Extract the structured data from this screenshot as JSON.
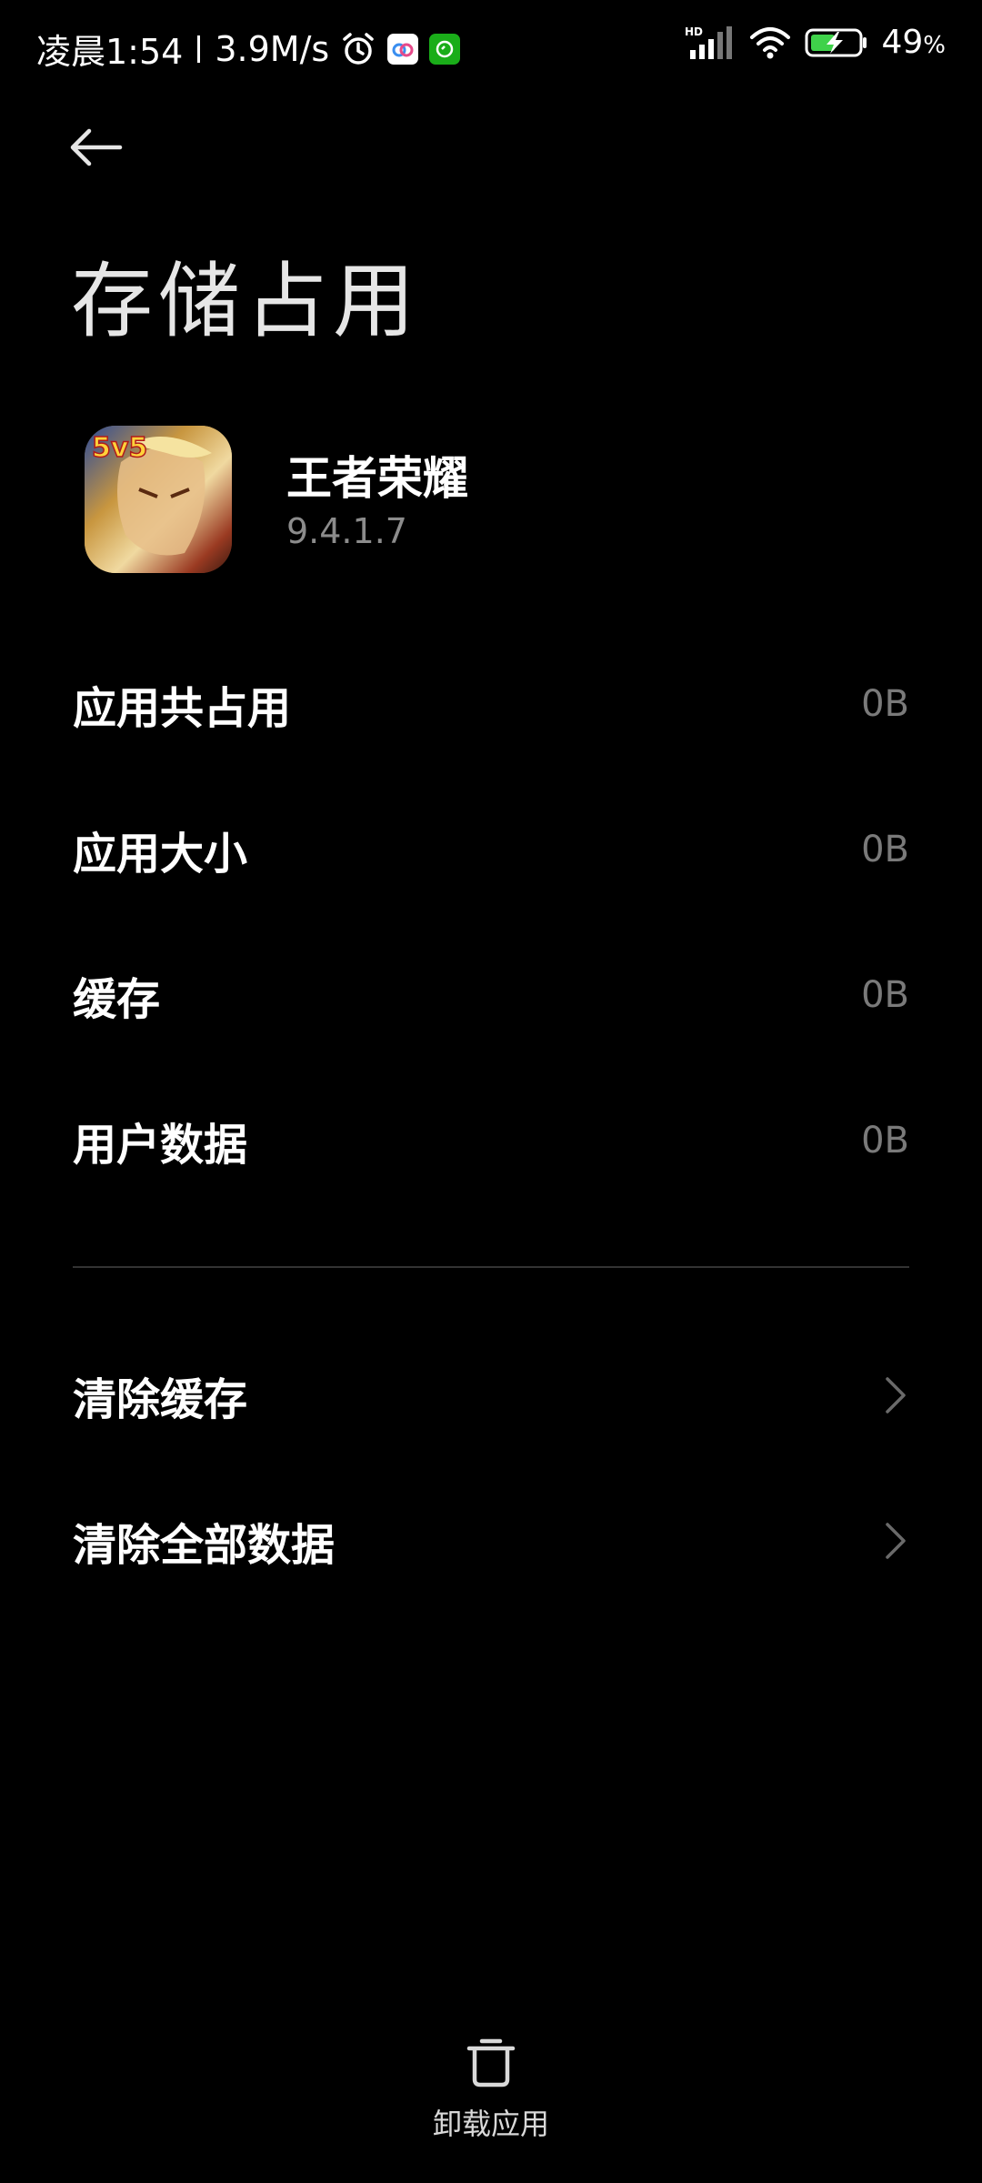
{
  "status_bar": {
    "time": "凌晨1:54",
    "speed": "3.9M/s",
    "network_badge": "HD",
    "battery_percent": "49",
    "battery_unit": "%",
    "icons": [
      "alarm-icon",
      "baidu-netdisk-icon",
      "wechat-icon",
      "signal-icon",
      "wifi-icon",
      "battery-icon"
    ]
  },
  "header": {
    "title": "存储占用"
  },
  "app": {
    "name": "王者荣耀",
    "version": "9.4.1.7",
    "icon_badge": "5v5"
  },
  "storage": {
    "rows": [
      {
        "label": "应用共占用",
        "value": "0B"
      },
      {
        "label": "应用大小",
        "value": "0B"
      },
      {
        "label": "缓存",
        "value": "0B"
      },
      {
        "label": "用户数据",
        "value": "0B"
      }
    ]
  },
  "actions": {
    "items": [
      {
        "label": "清除缓存"
      },
      {
        "label": "清除全部数据"
      }
    ]
  },
  "footer": {
    "uninstall_label": "卸载应用"
  },
  "colors": {
    "background": "#000000",
    "text_primary": "#ffffff",
    "text_secondary": "#7a7a7a",
    "divider": "#333333"
  }
}
